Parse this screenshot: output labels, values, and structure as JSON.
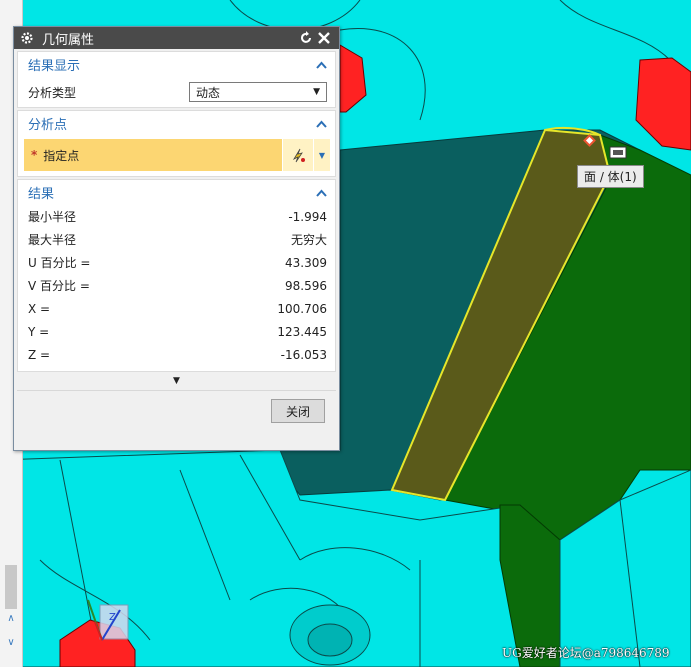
{
  "dialog": {
    "title": "几何属性",
    "icons": {
      "settings": "gear-icon",
      "reset": "reset-icon",
      "close": "close-icon"
    },
    "result_display": {
      "header": "结果显示",
      "analysis_type_label": "分析类型",
      "analysis_type_value": "动态"
    },
    "analysis_point": {
      "header": "分析点",
      "required_mark": "*",
      "specify_point_label": "指定点"
    },
    "results": {
      "header": "结果",
      "rows": [
        {
          "label": "最小半径",
          "value": "-1.994"
        },
        {
          "label": "最大半径",
          "value": "无穷大"
        },
        {
          "label": "U 百分比 =",
          "value": "43.309"
        },
        {
          "label": "V 百分比 =",
          "value": "98.596"
        },
        {
          "label": "X =",
          "value": "100.706"
        },
        {
          "label": "Y =",
          "value": "123.445"
        },
        {
          "label": "Z =",
          "value": "-16.053"
        }
      ]
    },
    "close_label": "关闭"
  },
  "viewport": {
    "tooltip": "面 / 体(1)",
    "watermark": "UG爱好者论坛@a798646789",
    "axis_label": "Z",
    "colors": {
      "background": "#00e6e6",
      "highlight": "#ff2222",
      "face": "#0a5f5f",
      "selected": "#5a5a1a",
      "green": "#0b6b0b"
    }
  }
}
